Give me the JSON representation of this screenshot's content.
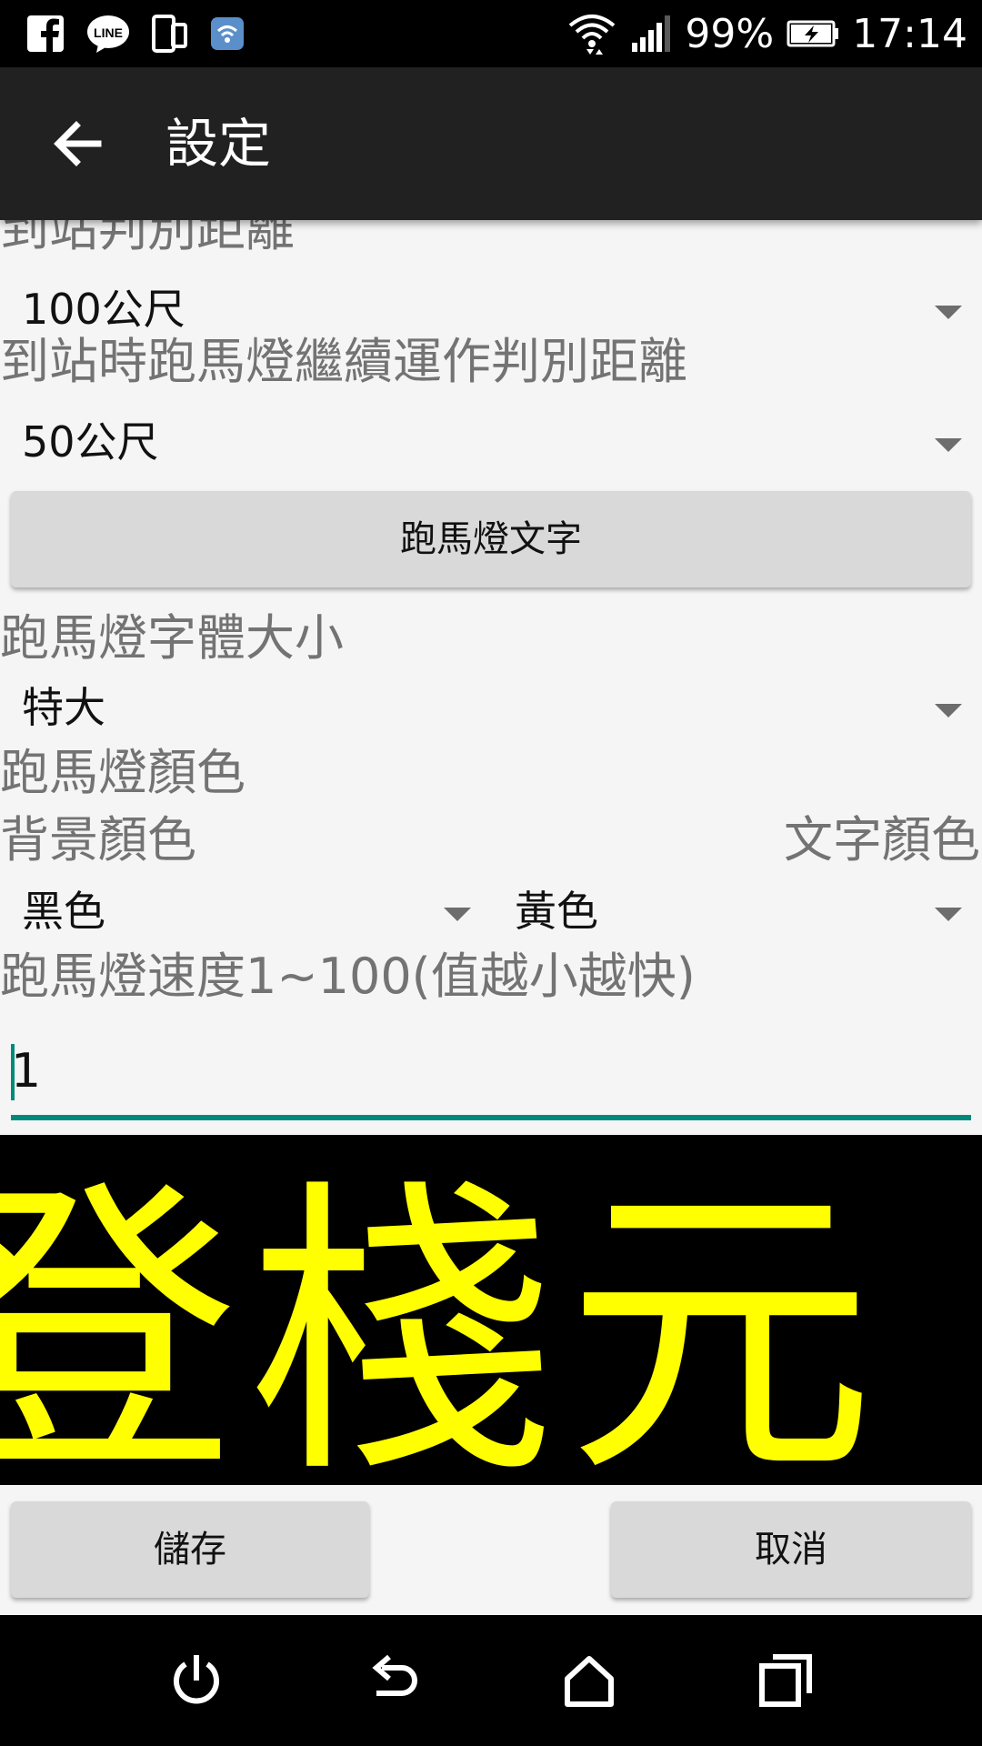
{
  "status_bar": {
    "left_icons": [
      "facebook-icon",
      "line-icon",
      "dual-screen-icon",
      "wifi-app-icon"
    ],
    "right_icons": [
      "wifi-icon",
      "signal-icon",
      "battery-charging-icon"
    ],
    "battery": "99%",
    "time": "17:14"
  },
  "app_bar": {
    "back_icon": "arrow-back-icon",
    "title": "設定"
  },
  "settings": {
    "arrival_distance": {
      "label": "到站判別距離",
      "value": "100公尺"
    },
    "marquee_continue_distance": {
      "label": "到站時跑馬燈繼續運作判別距離",
      "value": "50公尺"
    },
    "marquee_text_button": "跑馬燈文字",
    "font_size": {
      "label": "跑馬燈字體大小",
      "value": "特大"
    },
    "marquee_color": {
      "label": "跑馬燈顏色",
      "background_label": "背景顏色",
      "text_label": "文字顏色",
      "background_value": "黑色",
      "text_value": "黃色"
    },
    "speed": {
      "label": "跑馬燈速度1~100(值越小越快)",
      "value": "1"
    }
  },
  "preview": {
    "text": "登棧元",
    "background_color": "#000000",
    "text_color": "#ffff00"
  },
  "actions": {
    "save": "儲存",
    "cancel": "取消"
  },
  "nav_bar": {
    "icons": [
      "power-icon",
      "back-icon",
      "home-icon",
      "recents-icon"
    ]
  },
  "colors": {
    "accent": "#00897b",
    "app_bar": "#212121",
    "button": "#d9d9d9"
  }
}
